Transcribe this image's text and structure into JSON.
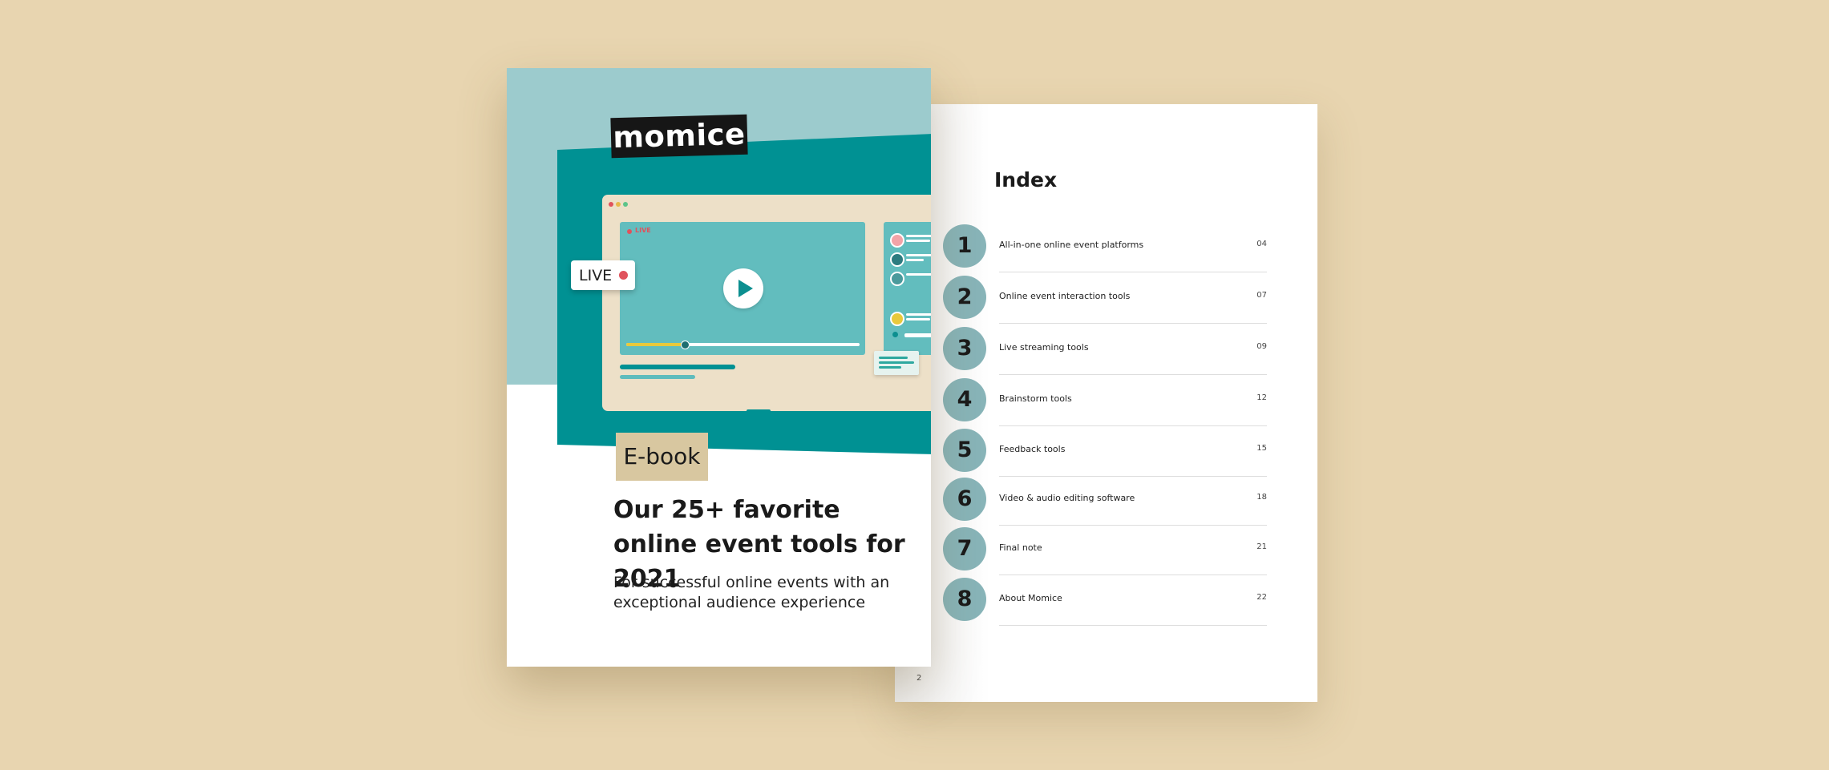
{
  "index_page": {
    "title": "Index",
    "items": [
      {
        "number": "1",
        "label": "All-in-one online event platforms",
        "page": "04"
      },
      {
        "number": "2",
        "label": "Online event interaction tools",
        "page": "07"
      },
      {
        "number": "3",
        "label": "Live streaming tools",
        "page": "09"
      },
      {
        "number": "4",
        "label": "Brainstorm tools",
        "page": "12"
      },
      {
        "number": "5",
        "label": "Feedback tools",
        "page": "15"
      },
      {
        "number": "6",
        "label": "Video & audio editing software",
        "page": "18"
      },
      {
        "number": "7",
        "label": "Final note",
        "page": "21"
      },
      {
        "number": "8",
        "label": "About Momice",
        "page": "22"
      }
    ],
    "page_number": "2"
  },
  "cover": {
    "logo_text": "momice",
    "live_badge": "LIVE",
    "video_live_label": "LIVE",
    "ebook_badge": "E-book",
    "title": "Our 25+ favorite online event tools for 2021",
    "subtitle": "For successful online events with an exceptional audience experience",
    "video_progress": 0.25
  },
  "colors": {
    "background": "#e8d5b0",
    "teal_dark": "#009193",
    "teal_light": "#9ccbcd",
    "circle": "#88b4b8",
    "ebook_badge": "#d8c7a0",
    "live_red": "#e0525c"
  }
}
